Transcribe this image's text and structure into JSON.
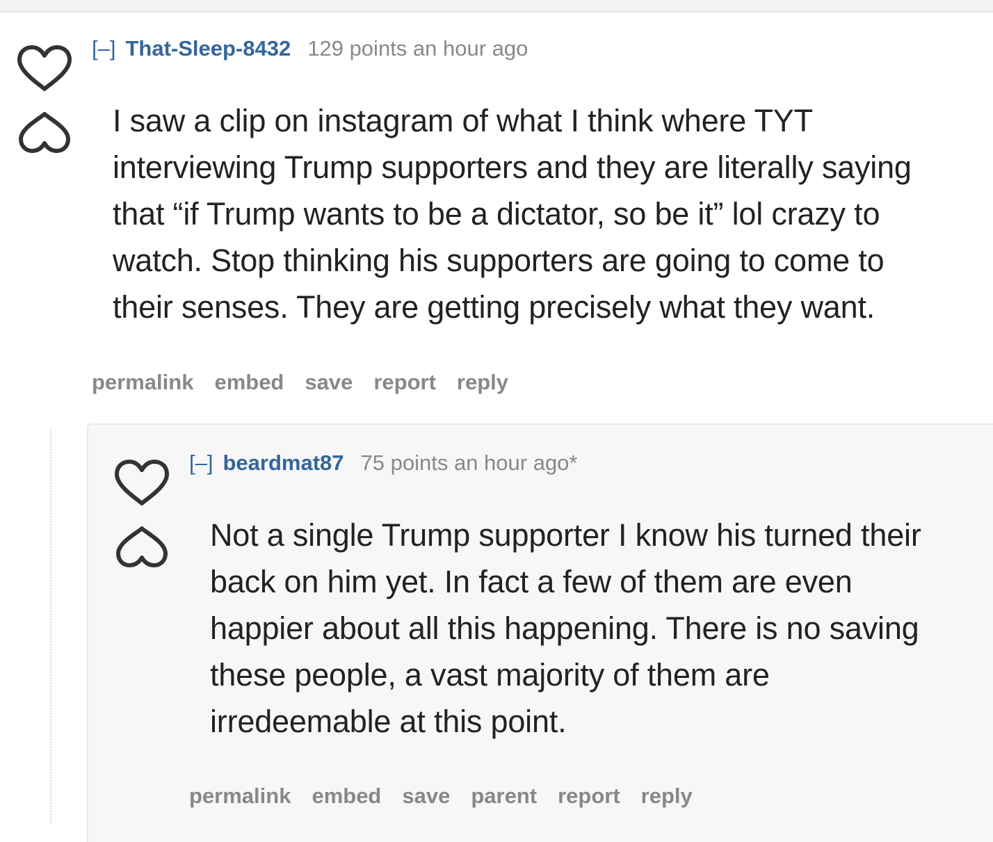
{
  "comments": [
    {
      "expand": "[–]",
      "author": "That-Sleep-8432",
      "score": "129 points",
      "time": "an hour ago",
      "body_lines": [
        "I saw a clip on instagram of what I think where TYT",
        "interviewing Trump supporters and they are literally saying",
        "that “if Trump wants to be a dictator, so be it” lol crazy to",
        "watch. Stop thinking his supporters are going to come to",
        "their senses. They are getting precisely what they want."
      ],
      "buttons": [
        "permalink",
        "embed",
        "save",
        "report",
        "reply"
      ]
    },
    {
      "expand": "[–]",
      "author": "beardmat87",
      "score": "75 points",
      "time": "an hour ago*",
      "body_lines": [
        "Not a single Trump supporter I know his turned their",
        "back on him yet. In fact a few of them are even",
        "happier about all this happening. There is no saving",
        "these people, a vast majority of them are",
        "irredeemable at this point."
      ],
      "buttons": [
        "permalink",
        "embed",
        "save",
        "parent",
        "report",
        "reply"
      ]
    }
  ],
  "icons": {
    "upvote": "heart-outline-icon",
    "downvote": "inverted-heart-outline-icon"
  }
}
